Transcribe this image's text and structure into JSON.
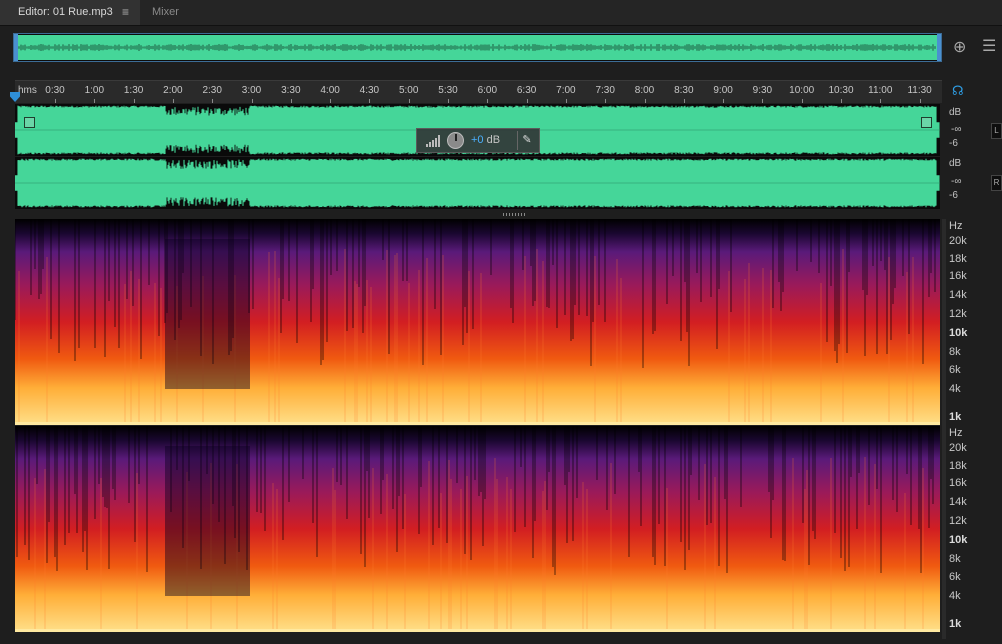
{
  "tabs": {
    "editor": "Editor: 01 Rue.mp3",
    "editor_menu": "≡",
    "mixer": "Mixer"
  },
  "ruler": {
    "unit": "hms",
    "labels": [
      "0:30",
      "1:00",
      "1:30",
      "2:00",
      "2:30",
      "3:00",
      "3:30",
      "4:00",
      "4:30",
      "5:00",
      "5:30",
      "6:00",
      "6:30",
      "7:00",
      "7:30",
      "8:00",
      "8:30",
      "9:00",
      "9:30",
      "10:00",
      "10:30",
      "11:00",
      "11:30"
    ]
  },
  "waveform": {
    "db_label": "dB",
    "db_inf": "-∞",
    "db_minus6": "-6",
    "channel_left_btn": "L",
    "channel_right_btn": "R"
  },
  "hud": {
    "gain_value": "+0",
    "gain_unit": "dB"
  },
  "spectral": {
    "unit": "Hz",
    "labels": [
      "20k",
      "18k",
      "16k",
      "14k",
      "12k",
      "10k",
      "8k",
      "6k",
      "4k",
      "1k"
    ]
  },
  "colors": {
    "waveform": "#45d699",
    "background": "#1e1e1e",
    "accent": "#2f8fd8"
  },
  "icons": {
    "tab_menu": "hamburger-icon",
    "zoom": "zoom-icon",
    "settings": "list-icon",
    "monitor": "headphone-icon",
    "volume": "volume-bars-icon",
    "pin": "pin-icon"
  }
}
